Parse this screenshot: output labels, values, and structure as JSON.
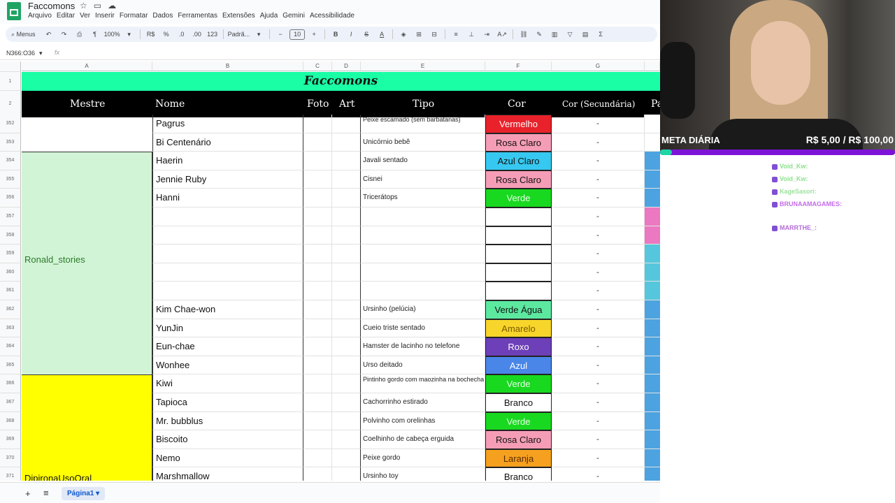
{
  "app": {
    "title": "Faccomons",
    "menu": [
      "Arquivo",
      "Editar",
      "Ver",
      "Inserir",
      "Formatar",
      "Dados",
      "Ferramentas",
      "Extensões",
      "Ajuda",
      "Gemini",
      "Acessibilidade"
    ]
  },
  "toolbar": {
    "search_label": "Menus",
    "zoom": "100%",
    "currency": "R$",
    "percent": "%",
    "dec_less": ".0",
    "dec_more": ".00",
    "num_format": "123",
    "font": "Padrã...",
    "font_size": "10"
  },
  "formula": {
    "cell_ref": "N366:O36",
    "fx": "fx"
  },
  "columns": [
    "A",
    "B",
    "C",
    "D",
    "E",
    "F",
    "G"
  ],
  "sheet": {
    "title": "Faccomons",
    "headers": {
      "mestre": "Mestre",
      "nome": "Nome",
      "foto": "Foto",
      "art": "Art",
      "tipo": "Tipo",
      "cor": "Cor",
      "cor_sec": "Cor (Secundária)",
      "pa": "Pa"
    },
    "row_numbers": [
      "1",
      "2",
      "352",
      "353",
      "354",
      "355",
      "356",
      "357",
      "358",
      "359",
      "360",
      "361",
      "362",
      "363",
      "364",
      "365",
      "366",
      "367",
      "368",
      "369",
      "370",
      "371"
    ],
    "mestres": [
      "Ronald_stories",
      "DipironaUsoOral"
    ],
    "rows": [
      {
        "nome": "Pagrus",
        "tipo": "Peixe escamado (sem barbatanas)",
        "cor": "Vermelho",
        "cor_bg": "#e8212b",
        "cor_fg": "#ffffff",
        "sec": "-",
        "pa": "",
        "pa_bg": "#ffffff"
      },
      {
        "nome": "Bi Centenário",
        "tipo": "Unicórnio bebê",
        "cor": "Rosa Claro",
        "cor_bg": "#f59db7",
        "cor_fg": "#111111",
        "sec": "-",
        "pa": "",
        "pa_bg": "#ffffff"
      },
      {
        "nome": "Haerin",
        "tipo": "Javali sentado",
        "cor": "Azul Claro",
        "cor_bg": "#36c8f0",
        "cor_fg": "#111111",
        "sec": "-",
        "pa": "Azul",
        "pa_bg": "#4ca3e0"
      },
      {
        "nome": "Jennie Ruby",
        "tipo": "Cisnei",
        "cor": "Rosa Claro",
        "cor_bg": "#f59db7",
        "cor_fg": "#111111",
        "sec": "-",
        "pa": "Azul",
        "pa_bg": "#4ca3e0"
      },
      {
        "nome": "Hanni",
        "tipo": "Tricerátops",
        "cor": "Verde",
        "cor_bg": "#18d91f",
        "cor_fg": "#e8ffe8",
        "sec": "-",
        "pa": "Azul",
        "pa_bg": "#4ca3e0"
      },
      {
        "nome": "",
        "tipo": "",
        "cor": "",
        "cor_bg": "#ffffff",
        "cor_fg": "#111111",
        "sec": "-",
        "pa": "Rosa",
        "pa_bg": "#eb78c0"
      },
      {
        "nome": "",
        "tipo": "",
        "cor": "",
        "cor_bg": "#ffffff",
        "cor_fg": "#111111",
        "sec": "-",
        "pa": "Rosa",
        "pa_bg": "#eb78c0"
      },
      {
        "nome": "",
        "tipo": "",
        "cor": "",
        "cor_bg": "#ffffff",
        "cor_fg": "#111111",
        "sec": "-",
        "pa": "Azul",
        "pa_bg": "#56c6dc"
      },
      {
        "nome": "",
        "tipo": "",
        "cor": "",
        "cor_bg": "#ffffff",
        "cor_fg": "#111111",
        "sec": "-",
        "pa": "Azul",
        "pa_bg": "#56c6dc"
      },
      {
        "nome": "",
        "tipo": "",
        "cor": "",
        "cor_bg": "#ffffff",
        "cor_fg": "#111111",
        "sec": "-",
        "pa": "Azul",
        "pa_bg": "#56c6dc"
      },
      {
        "nome": "Kim Chae-won",
        "tipo": "Ursinho (pelúcia)",
        "cor": "Verde Água",
        "cor_bg": "#5de8a0",
        "cor_fg": "#111111",
        "sec": "-",
        "pa": "Azul",
        "pa_bg": "#4ca3e0"
      },
      {
        "nome": "YunJin",
        "tipo": "Cueio triste sentado",
        "cor": "Amarelo",
        "cor_bg": "#f7d52a",
        "cor_fg": "#7a5a00",
        "sec": "-",
        "pa": "Azul",
        "pa_bg": "#4ca3e0"
      },
      {
        "nome": "Eun-chae",
        "tipo": "Hamster de lacinho no telefone",
        "cor": "Roxo",
        "cor_bg": "#6d3fb8",
        "cor_fg": "#ffffff",
        "sec": "-",
        "pa": "Azul",
        "pa_bg": "#4ca3e0"
      },
      {
        "nome": "Wonhee",
        "tipo": "Urso deitado",
        "cor": "Azul",
        "cor_bg": "#4a86e8",
        "cor_fg": "#ffffff",
        "sec": "-",
        "pa": "Azul",
        "pa_bg": "#4ca3e0"
      },
      {
        "nome": "Kiwi",
        "tipo": "Pintinho gordo com maozinha na bochecha",
        "cor": "Verde",
        "cor_bg": "#18d91f",
        "cor_fg": "#e8ffe8",
        "sec": "-",
        "pa": "Azul",
        "pa_bg": "#4ca3e0"
      },
      {
        "nome": "Tapioca",
        "tipo": "Cachorrinho estirado",
        "cor": "Branco",
        "cor_bg": "#ffffff",
        "cor_fg": "#111111",
        "sec": "-",
        "pa": "Azul",
        "pa_bg": "#4ca3e0"
      },
      {
        "nome": "Mr. bubblus",
        "tipo": "Polvinho com orelinhas",
        "cor": "Verde",
        "cor_bg": "#18d91f",
        "cor_fg": "#e8ffe8",
        "sec": "-",
        "pa": "Azul",
        "pa_bg": "#4ca3e0"
      },
      {
        "nome": "Biscoito",
        "tipo": "Coelhinho de cabeça erguida",
        "cor": "Rosa Claro",
        "cor_bg": "#f59db7",
        "cor_fg": "#111111",
        "sec": "-",
        "pa": "Azul",
        "pa_bg": "#4ca3e0"
      },
      {
        "nome": "Nemo",
        "tipo": "Peixe gordo",
        "cor": "Laranja",
        "cor_bg": "#f5a01f",
        "cor_fg": "#5a2c00",
        "sec": "-",
        "pa": "Azul",
        "pa_bg": "#4ca3e0"
      },
      {
        "nome": "Marshmallow",
        "tipo": "Ursinho toy",
        "cor": "Branco",
        "cor_bg": "#ffffff",
        "cor_fg": "#111111",
        "sec": "-",
        "pa": "Azul",
        "pa_bg": "#4ca3e0"
      }
    ]
  },
  "bottom": {
    "sheet_tab": "Página1"
  },
  "stream": {
    "meta_label": "META DIÁRIA",
    "meta_value": "R$ 5,00 / R$ 100,00",
    "meta_progress": 0.05,
    "chat": [
      {
        "user": "Void_Kw:",
        "color": "#8de08d",
        "text": ""
      },
      {
        "user": "Void_Kw:",
        "color": "#8de08d",
        "text": ""
      },
      {
        "user": "KageSasori:",
        "color": "#9be29b",
        "text": ""
      },
      {
        "user": "BRUNAAMAGAMES:",
        "color": "#c46be8",
        "text": ""
      },
      {
        "user": "MARRTHE_:",
        "color": "#b56bd8",
        "text": ""
      }
    ]
  }
}
